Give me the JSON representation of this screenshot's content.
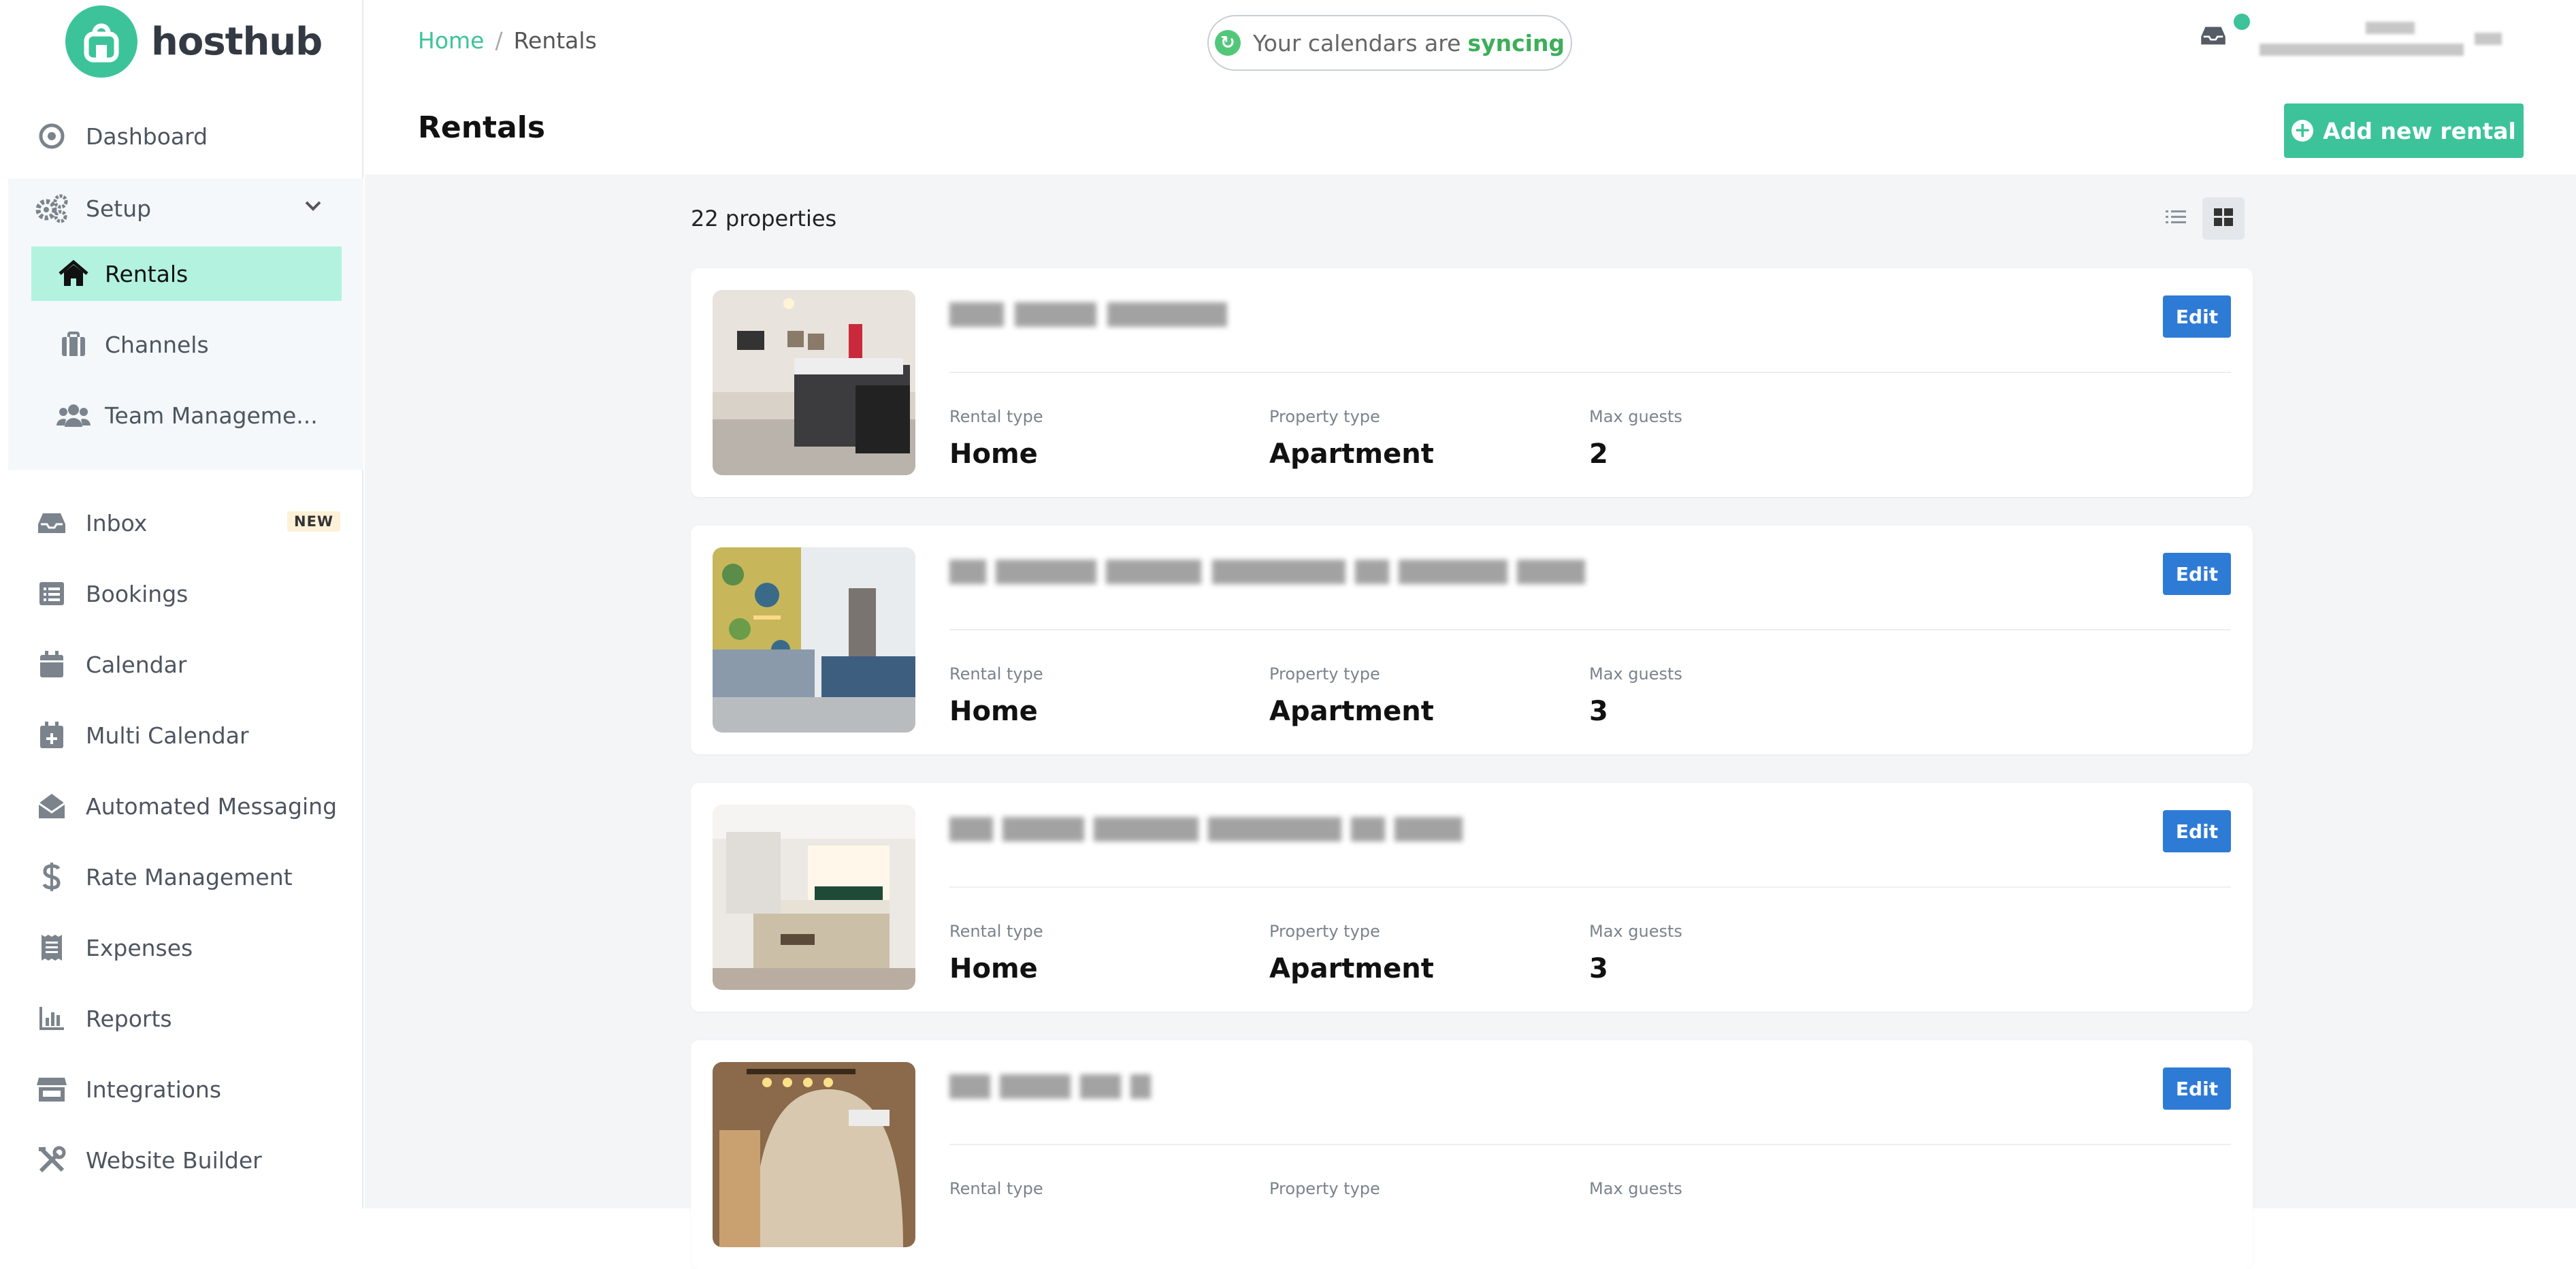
{
  "brand": {
    "name": "hosthub",
    "color": "#3cc39a"
  },
  "sidebar": {
    "dashboard": {
      "label": "Dashboard",
      "icon": "dashboard-icon"
    },
    "setup": {
      "label": "Setup",
      "icon": "gears-icon",
      "expanded": true,
      "children": [
        {
          "label": "Rentals",
          "icon": "home-icon",
          "active": true
        },
        {
          "label": "Channels",
          "icon": "briefcase-icon"
        },
        {
          "label": "Team Manageme...",
          "icon": "users-icon"
        }
      ]
    },
    "items": [
      {
        "label": "Inbox",
        "icon": "inbox-icon",
        "badge": "NEW"
      },
      {
        "label": "Bookings",
        "icon": "list-icon"
      },
      {
        "label": "Calendar",
        "icon": "calendar-icon"
      },
      {
        "label": "Multi Calendar",
        "icon": "calendar-plus-icon"
      },
      {
        "label": "Automated Messaging",
        "icon": "envelope-open-icon"
      },
      {
        "label": "Rate Management",
        "icon": "dollar-icon"
      },
      {
        "label": "Expenses",
        "icon": "receipt-icon"
      },
      {
        "label": "Reports",
        "icon": "bar-chart-icon"
      },
      {
        "label": "Integrations",
        "icon": "store-icon"
      },
      {
        "label": "Website Builder",
        "icon": "tools-icon"
      }
    ]
  },
  "header": {
    "breadcrumb": {
      "home": "Home",
      "separator": "/",
      "current": "Rentals"
    },
    "sync": {
      "text": "Your calendars are",
      "status": "syncing"
    },
    "page_title": "Rentals",
    "add_button": "Add new rental"
  },
  "main": {
    "count": "22 properties",
    "view_mode": "grid",
    "field_labels": {
      "rental_type": "Rental type",
      "property_type": "Property type",
      "max_guests": "Max guests"
    },
    "edit_label": "Edit",
    "rentals": [
      {
        "rental_type": "Home",
        "property_type": "Apartment",
        "max_guests": "2"
      },
      {
        "rental_type": "Home",
        "property_type": "Apartment",
        "max_guests": "3"
      },
      {
        "rental_type": "Home",
        "property_type": "Apartment",
        "max_guests": "3"
      },
      {
        "rental_type": "",
        "property_type": "",
        "max_guests": ""
      }
    ]
  },
  "colors": {
    "accent": "#3cc39a",
    "edit": "#2e7bd6",
    "active_nav": "#b2f2df",
    "syncing": "#3cae5a"
  }
}
